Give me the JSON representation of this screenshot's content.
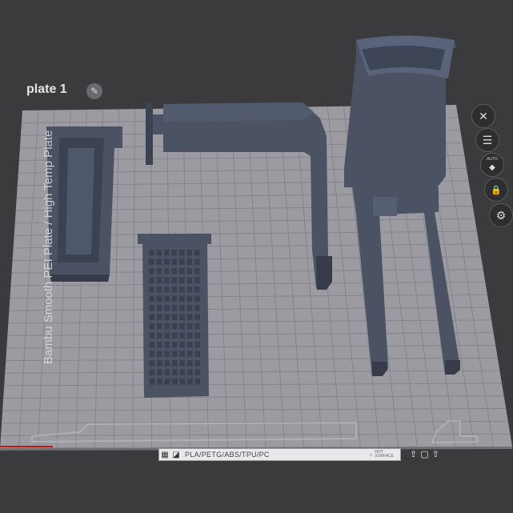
{
  "viewport": {
    "plate_label": "plate 1",
    "plate_text": "Bambu Smooth PEI Plate / High Temp Plate",
    "colors": {
      "background": "#3b3b3d",
      "bed": "#9a9aa0",
      "grid": "#85858b",
      "part": "#4a5263",
      "part_shadow": "#363c49",
      "axis_x": "#c0161b"
    }
  },
  "side_toolbar": {
    "items": [
      {
        "name": "close-icon",
        "glyph": "✕"
      },
      {
        "name": "list-icon",
        "glyph": "☰"
      },
      {
        "name": "auto-orient-icon",
        "glyph": "◆",
        "label": "AUTO"
      },
      {
        "name": "lock-icon",
        "glyph": "🔒"
      },
      {
        "name": "gear-icon",
        "glyph": "⚙"
      }
    ]
  },
  "bottom_bar": {
    "filament": "PLA/PETG/ABS/TPU/PC",
    "surface": "HOT\nSURFACE"
  }
}
